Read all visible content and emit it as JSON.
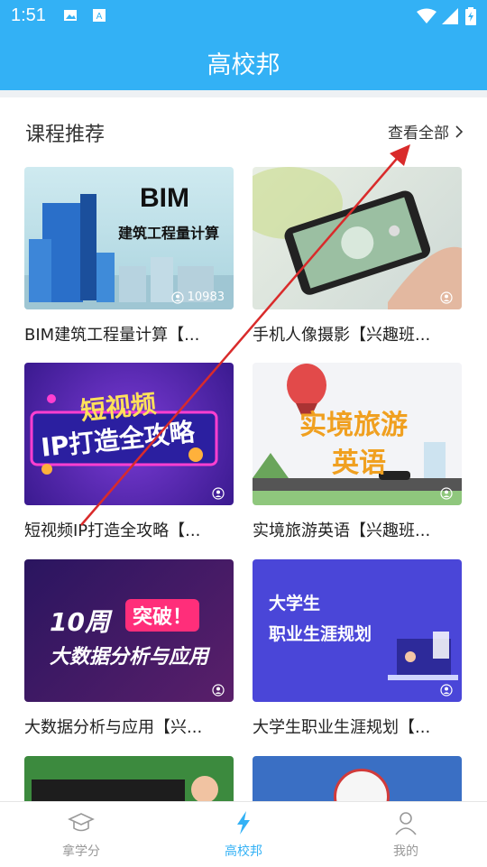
{
  "status_bar": {
    "time": "1:51",
    "icons": [
      "image-icon",
      "font-icon",
      "wifi-icon",
      "signal-icon",
      "battery-icon"
    ]
  },
  "app_bar": {
    "title": "高校邦"
  },
  "section": {
    "title": "课程推荐",
    "view_all": "查看全部"
  },
  "courses": [
    {
      "label": "BIM建筑工程量计算【...",
      "count": "10983",
      "thumb_title": "BIM",
      "thumb_subtitle": "建筑工程量计算"
    },
    {
      "label": "手机人像摄影【兴趣班...",
      "count": ""
    },
    {
      "label": "短视频IP打造全攻略【...",
      "count": "",
      "thumb_title": "短视频",
      "thumb_subtitle": "IP打造全攻略"
    },
    {
      "label": "实境旅游英语【兴趣班...",
      "count": "",
      "thumb_title": "实境旅游",
      "thumb_subtitle": "英语"
    },
    {
      "label": "大数据分析与应用【兴...",
      "count": "",
      "thumb_title": "10周",
      "thumb_badge": "突破！",
      "thumb_subtitle": "大数据分析与应用"
    },
    {
      "label": "大学生职业生涯规划【...",
      "count": "",
      "thumb_title": "大学生",
      "thumb_subtitle": "职业生涯规划"
    }
  ],
  "bottom_nav": [
    {
      "label": "拿学分",
      "icon": "graduation-cap-icon"
    },
    {
      "label": "高校邦",
      "icon": "lightning-icon",
      "active": true
    },
    {
      "label": "我的",
      "icon": "person-icon"
    }
  ],
  "colors": {
    "primary": "#33b1f5",
    "text": "#333333",
    "inactive": "#999999"
  }
}
